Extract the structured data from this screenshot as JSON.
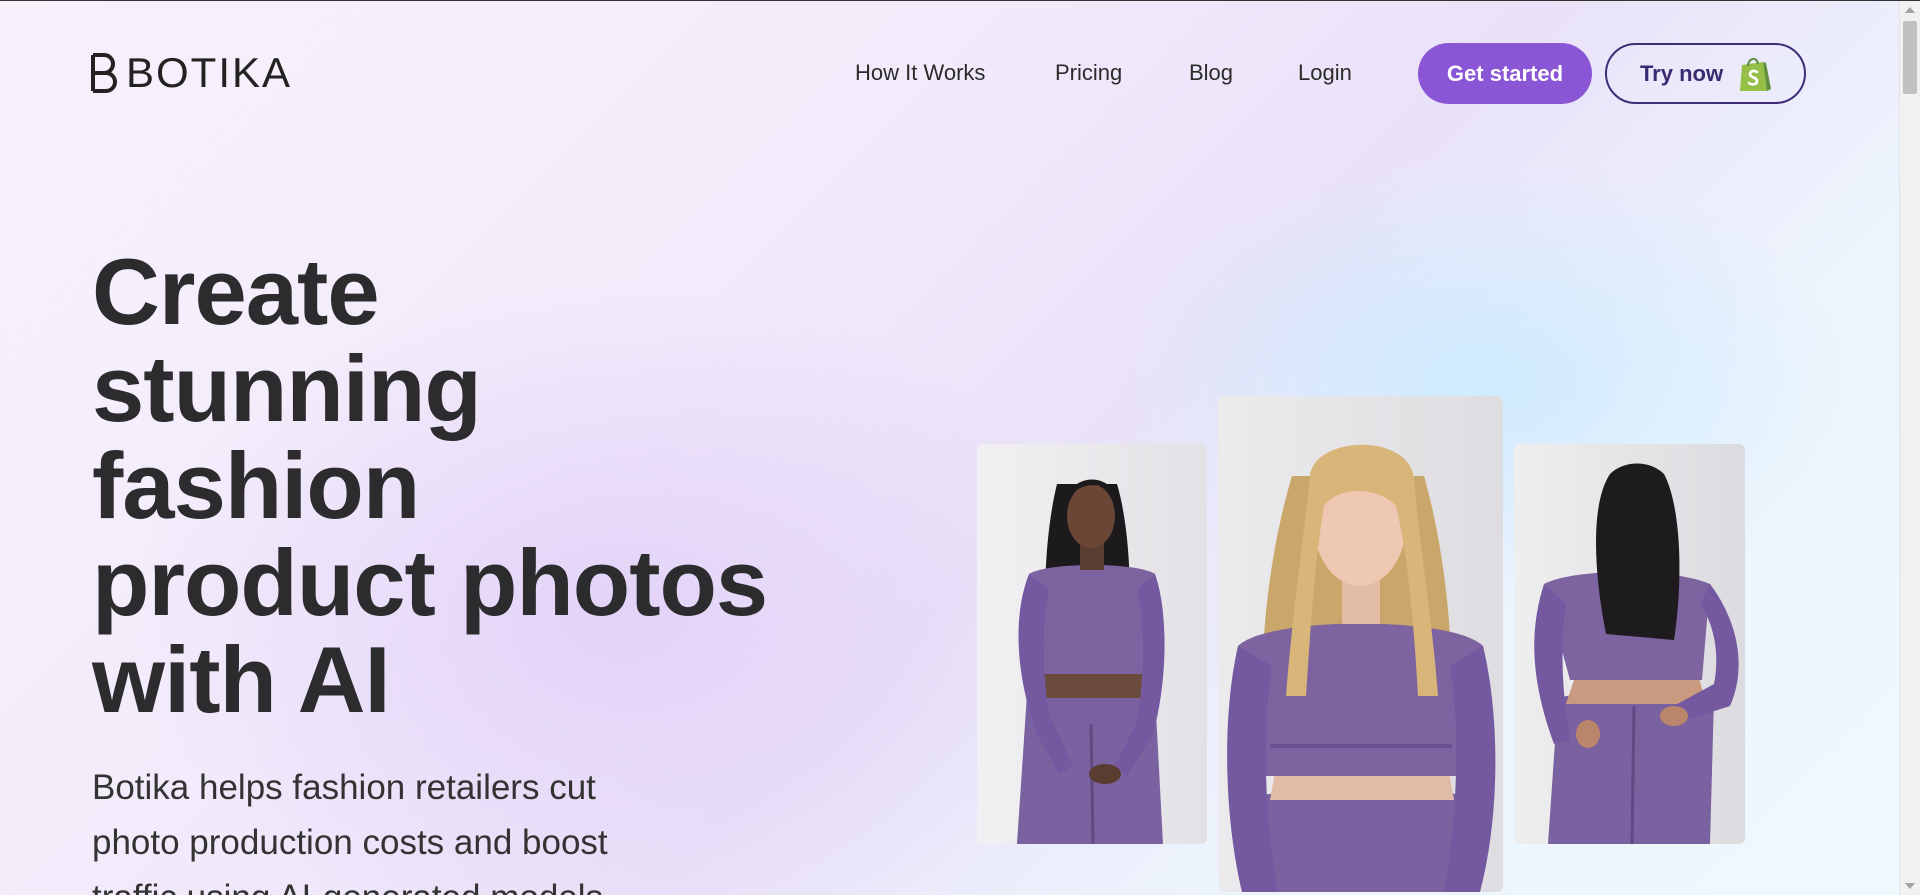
{
  "brand": {
    "name": "BOTIKA",
    "accent": "#8b56d6",
    "outline": "#3f2d78"
  },
  "nav": {
    "items": [
      {
        "label": "How It Works"
      },
      {
        "label": "Pricing"
      },
      {
        "label": "Blog"
      },
      {
        "label": "Login"
      }
    ],
    "cta_primary": "Get started",
    "cta_secondary": "Try now",
    "cta_secondary_icon": "shopify-bag-icon"
  },
  "hero": {
    "title_lines": [
      "Create",
      "stunning",
      "fashion",
      "product photos",
      "with AI"
    ],
    "subtitle_lines": [
      "Botika helps fashion retailers cut",
      "photo production costs and boost",
      "traffic using AI-generated models"
    ]
  },
  "photos": [
    {
      "name": "model-photo-front-dark-hair"
    },
    {
      "name": "model-photo-front-blonde"
    },
    {
      "name": "model-photo-back-view"
    }
  ],
  "outfit_color": "#7d64a1"
}
